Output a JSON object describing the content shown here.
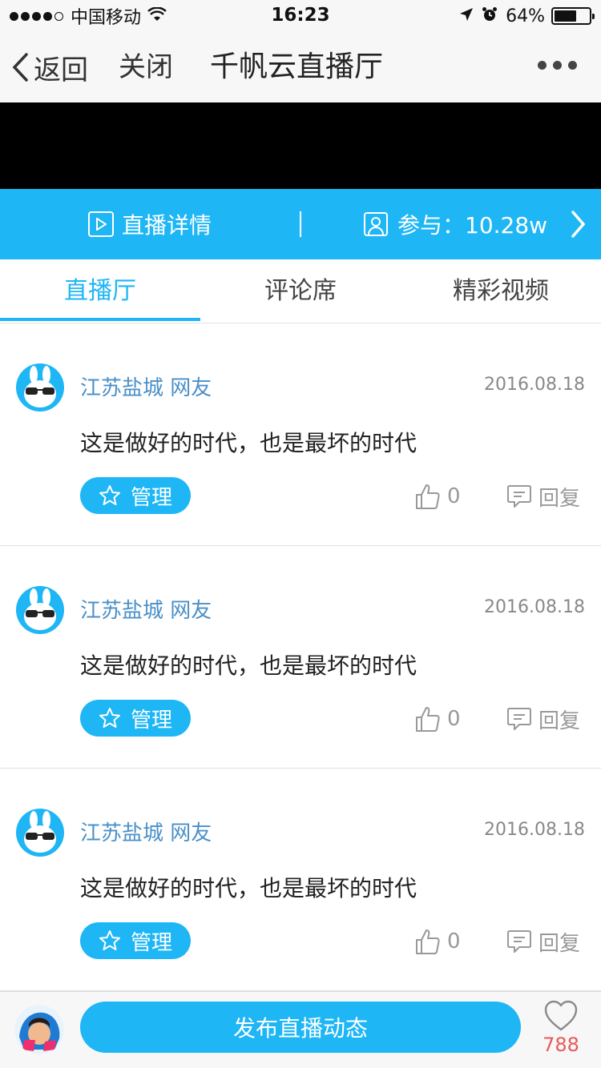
{
  "status_bar": {
    "carrier": "中国移动",
    "time": "16:23",
    "battery": "64%",
    "battery_level": 0.64
  },
  "nav": {
    "back_label": "返回",
    "close_label": "关闭",
    "title": "千帆云直播厅",
    "more_icon": "more-dots-icon"
  },
  "info_bar": {
    "detail_label": "直播详情",
    "participants_label": "参与：10.28w"
  },
  "tabs": [
    {
      "label": "直播厅",
      "active": true
    },
    {
      "label": "评论席",
      "active": false
    },
    {
      "label": "精彩视频",
      "active": false
    }
  ],
  "posts": [
    {
      "user": "江苏盐城 网友",
      "date": "2016.08.18",
      "content": "这是做好的时代，也是最坏的时代",
      "manage_label": "管理",
      "likes": "0",
      "reply_label": "回复"
    },
    {
      "user": "江苏盐城 网友",
      "date": "2016.08.18",
      "content": "这是做好的时代，也是最坏的时代",
      "manage_label": "管理",
      "likes": "0",
      "reply_label": "回复"
    },
    {
      "user": "江苏盐城 网友",
      "date": "2016.08.18",
      "content": "这是做好的时代，也是最坏的时代",
      "manage_label": "管理",
      "likes": "0",
      "reply_label": "回复"
    }
  ],
  "bottom": {
    "publish_label": "发布直播动态",
    "heart_count": "788"
  },
  "colors": {
    "accent": "#1eb6f5",
    "username": "#4a90c8",
    "heart_count": "#e65b5b"
  }
}
